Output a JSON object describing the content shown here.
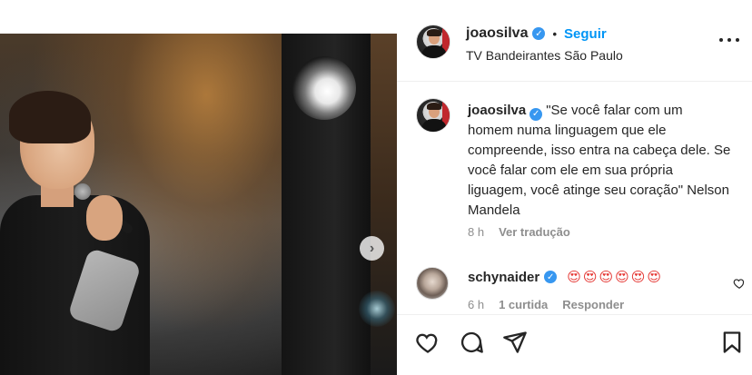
{
  "post": {
    "author": {
      "username": "joaosilva",
      "verified": true,
      "follow_label": "Seguir",
      "separator": "•",
      "location": "TV Bandeirantes São Paulo"
    },
    "caption": {
      "username": "joaosilva",
      "text": "\"Se você falar com um homem numa linguagem que ele compreende, isso entra na cabeça dele. Se você falar com ele em sua própria liguagem, você atinge seu coração\" Nelson Mandela",
      "time": "8 h",
      "translate_label": "Ver tradução"
    },
    "comments": [
      {
        "username": "schynaider",
        "verified": true,
        "text": "😍😍😍😍😍😍",
        "time": "6 h",
        "likes": "1 curtida",
        "reply_label": "Responder"
      }
    ]
  },
  "colors": {
    "accent": "#0095f6",
    "verified": "#3797f0",
    "text": "#262626",
    "muted": "#8e8e8e"
  },
  "icons": {
    "more": "more-options-icon",
    "next": "chevron-right-icon",
    "like": "heart-icon",
    "comment": "comment-icon",
    "share": "paper-plane-icon",
    "save": "bookmark-icon"
  }
}
